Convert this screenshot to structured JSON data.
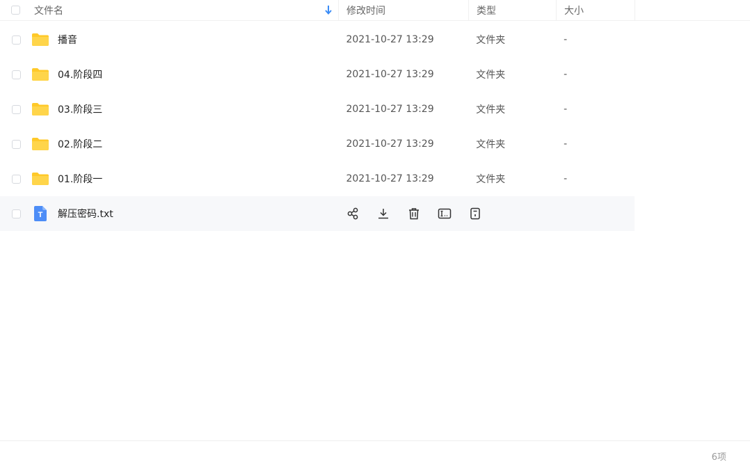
{
  "header": {
    "name_label": "文件名",
    "time_label": "修改时间",
    "type_label": "类型",
    "size_label": "大小"
  },
  "files": [
    {
      "name": "播音",
      "modified": "2021-10-27 13:29",
      "type": "文件夹",
      "size": "-",
      "icon": "folder-icon"
    },
    {
      "name": "04.阶段四",
      "modified": "2021-10-27 13:29",
      "type": "文件夹",
      "size": "-",
      "icon": "folder-icon"
    },
    {
      "name": "03.阶段三",
      "modified": "2021-10-27 13:29",
      "type": "文件夹",
      "size": "-",
      "icon": "folder-icon"
    },
    {
      "name": "02.阶段二",
      "modified": "2021-10-27 13:29",
      "type": "文件夹",
      "size": "-",
      "icon": "folder-icon"
    },
    {
      "name": "01.阶段一",
      "modified": "2021-10-27 13:29",
      "type": "文件夹",
      "size": "-",
      "icon": "folder-icon"
    },
    {
      "name": "解压密码.txt",
      "icon": "txt-file-icon",
      "icon_letter": "T"
    }
  ],
  "footer": {
    "count": "6项"
  },
  "colors": {
    "accent": "#3b8cf6",
    "folder": "#ffca28",
    "row_hover": "#f7f8fa"
  }
}
